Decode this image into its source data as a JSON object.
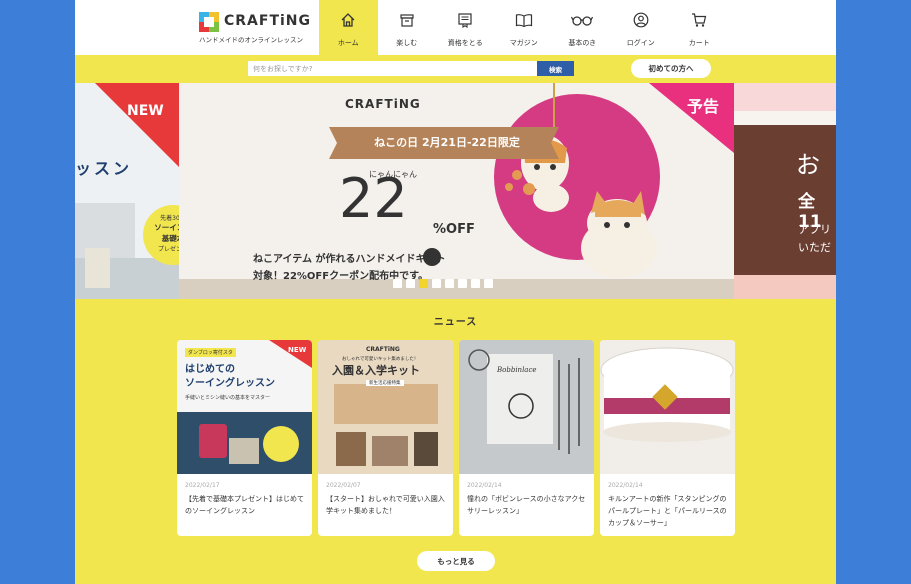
{
  "brand": {
    "name": "CRAFTiNG",
    "tagline": "ハンドメイドのオンラインレッスン"
  },
  "nav": [
    {
      "label": "ホーム",
      "icon": "home-icon"
    },
    {
      "label": "楽しむ",
      "icon": "box-icon"
    },
    {
      "label": "資格をとる",
      "icon": "certificate-icon"
    },
    {
      "label": "マガジン",
      "icon": "book-icon"
    },
    {
      "label": "基本のき",
      "icon": "glasses-icon"
    },
    {
      "label": "ログイン",
      "icon": "user-icon"
    },
    {
      "label": "カート",
      "icon": "cart-icon"
    }
  ],
  "search": {
    "placeholder": "何をお探しですか?",
    "button": "検索"
  },
  "first_time_button": "初めての方へ",
  "banners": {
    "left": {
      "badge": "NEW",
      "title": "ッスン",
      "sticker_line1": "先着30名",
      "sticker_line2": "ソーイング",
      "sticker_line3": "基礎本",
      "sticker_line4": "プレゼント"
    },
    "main": {
      "logo": "CRAFTiNG",
      "ribbon": "ねこの日 2月21日-22日限定",
      "badge": "予告",
      "small": "にゃんにゃん",
      "percent": "22",
      "off": "%OFF",
      "line1": "ねこアイテム が作れるハンドメイドキット",
      "line2": "対象！22%OFFクーポン配布中です。"
    },
    "right": {
      "title": "お",
      "line1": "全11",
      "line2": "アプリ",
      "line3": "いただ"
    }
  },
  "carousel": {
    "slide_count": 8,
    "active_index": 2
  },
  "news": {
    "title": "ニュース",
    "cards": [
      {
        "date": "2022/02/17",
        "text": "【先着で基礎本プレゼント】はじめてのソーイングレッスン",
        "img_tag": "ダンブロッ寄付スタ",
        "img_badge": "NEW",
        "img_title1": "はじめての",
        "img_title2": "ソーイングレッスン",
        "img_sub": "手縫いとミシン縫いの基本をマスター"
      },
      {
        "date": "2022/02/07",
        "text": "【スタート】おしゃれで可愛い入園入学キット集めました！",
        "img_logo": "CRAFTiNG",
        "img_tag": "おしゃれで可愛いキット集めました！",
        "img_title": "入園＆入学キット",
        "img_sub": "新生活応援特集"
      },
      {
        "date": "2022/02/14",
        "text": "憧れの「ボビンレースの小さなアクセサリーレッスン」",
        "img_title": "Bobbinlace"
      },
      {
        "date": "2022/02/14",
        "text": "キルンアートの新作「スタンピングのパールプレート」と「パールリースのカップ＆ソーサー」"
      }
    ]
  },
  "more_button": "もっと見る",
  "colors": {
    "outer_bg": "#3d7ed9",
    "page_bg": "#f2e64f",
    "accent_blue": "#2f5ea8",
    "badge_red": "#e8393a",
    "badge_pink": "#e8307f",
    "ribbon_brown": "#b5835a"
  }
}
